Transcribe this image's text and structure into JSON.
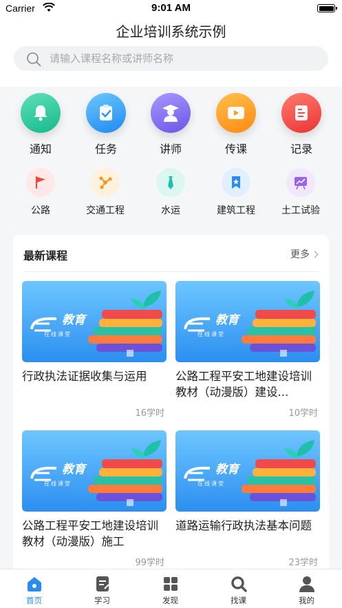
{
  "status_bar": {
    "carrier": "Carrier",
    "time": "9:01 AM"
  },
  "header": {
    "title": "企业培训系统示例",
    "search_placeholder": "请输入课程名称或讲师名称"
  },
  "main_icons": [
    {
      "label": "通知",
      "icon": "bell-icon",
      "color": "#21c79a"
    },
    {
      "label": "任务",
      "icon": "task-icon",
      "color": "#2a9bf5"
    },
    {
      "label": "讲师",
      "icon": "teacher-icon",
      "color": "#7a68ec"
    },
    {
      "label": "传课",
      "icon": "video-icon",
      "color": "#ff9a1f"
    },
    {
      "label": "记录",
      "icon": "record-icon",
      "color": "#f04a4a"
    }
  ],
  "categories": [
    {
      "label": "公路",
      "icon": "flag-icon",
      "color": "#f0453c"
    },
    {
      "label": "交通工程",
      "icon": "nodes-icon",
      "color": "#f29a18"
    },
    {
      "label": "水运",
      "icon": "tie-icon",
      "color": "#1fbfa9"
    },
    {
      "label": "建筑工程",
      "icon": "bookmark-icon",
      "color": "#2a8cf0"
    },
    {
      "label": "土工试验",
      "icon": "chart-board-icon",
      "color": "#9b63e8"
    }
  ],
  "latest": {
    "title": "最新课程",
    "more": "更多",
    "thumb_brand": "教育",
    "thumb_sub": "在线课堂",
    "courses": [
      {
        "title": "行政执法证据收集与运用",
        "hours": "16学时"
      },
      {
        "title": "公路工程平安工地建设培训教材（动漫版）建设...",
        "hours": "10学时"
      },
      {
        "title": "公路工程平安工地建设培训教材（动漫版）施工",
        "hours": "99学时"
      },
      {
        "title": "道路运输行政执法基本问题",
        "hours": "23学时"
      }
    ]
  },
  "tabs": [
    {
      "label": "首页",
      "icon": "home-icon",
      "active": true
    },
    {
      "label": "学习",
      "icon": "study-icon",
      "active": false
    },
    {
      "label": "发现",
      "icon": "discover-icon",
      "active": false
    },
    {
      "label": "找课",
      "icon": "find-course-icon",
      "active": false
    },
    {
      "label": "我的",
      "icon": "profile-icon",
      "active": false
    }
  ],
  "colors": {
    "accent": "#2a8cf0",
    "inactive_tab": "#555555"
  }
}
